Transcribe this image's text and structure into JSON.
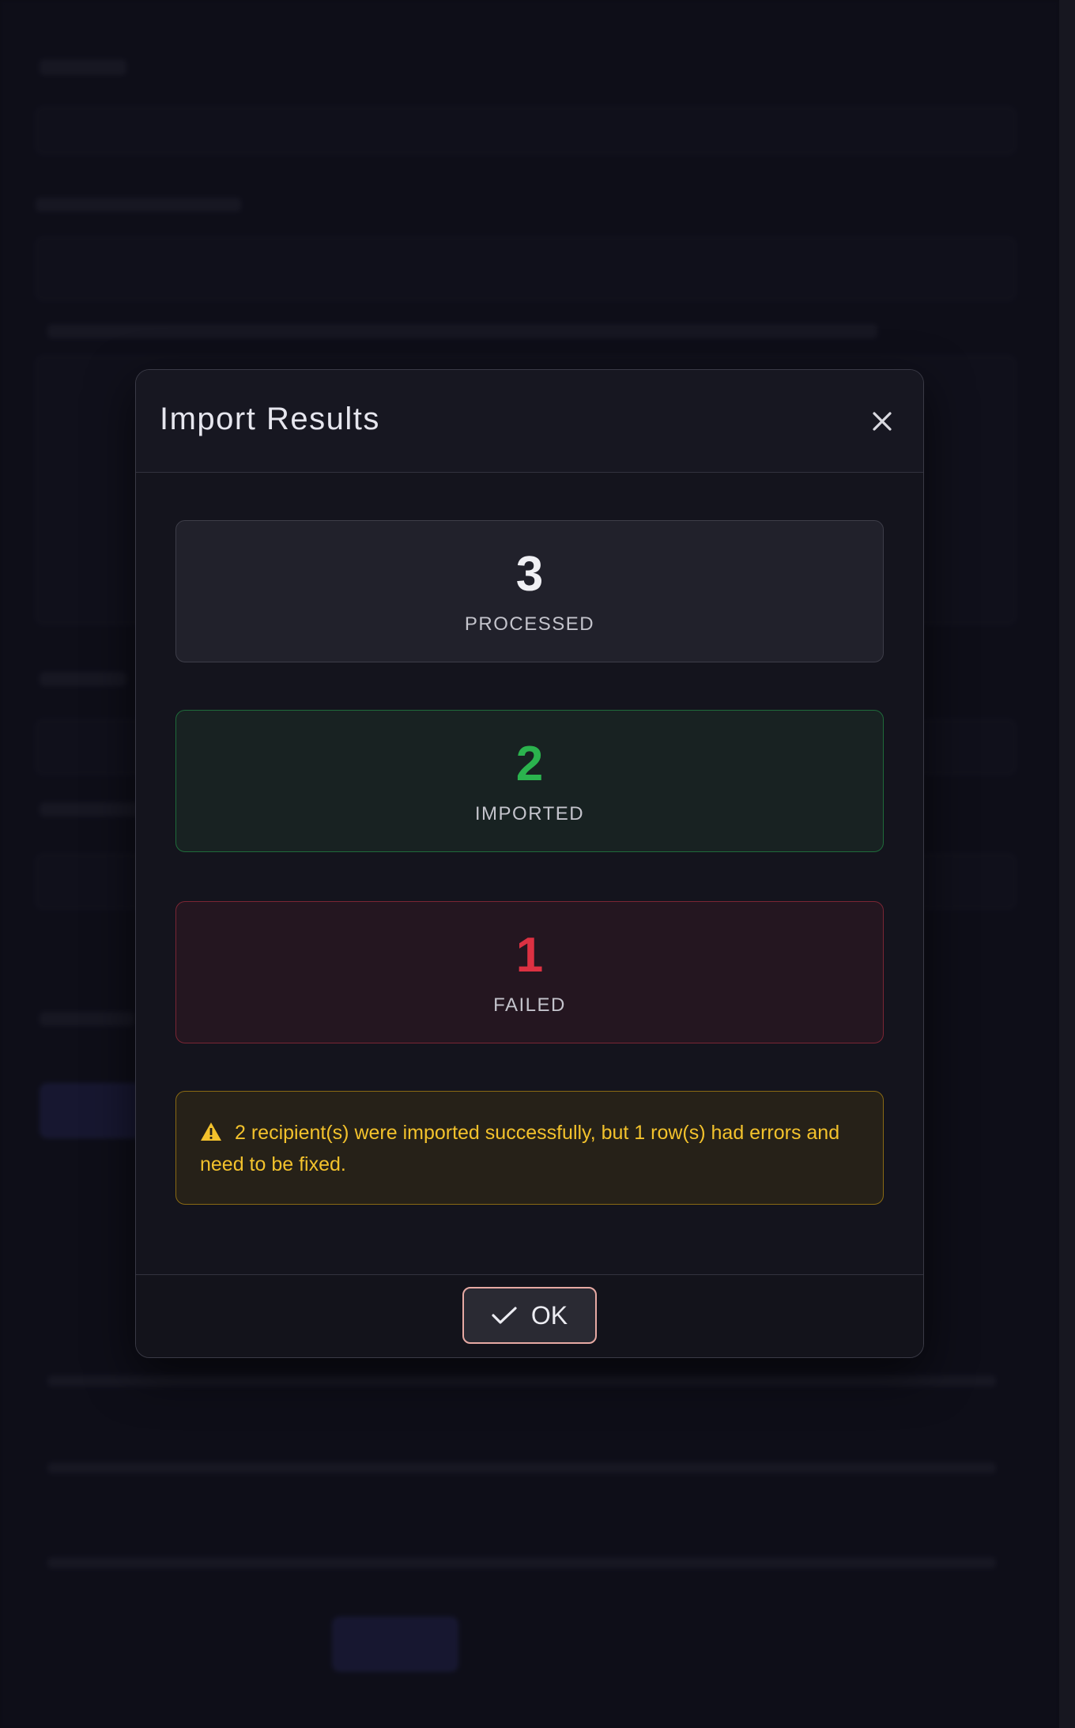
{
  "modal": {
    "title": "Import Results",
    "close_icon": "close-icon",
    "stats": [
      {
        "value": "3",
        "label": "PROCESSED"
      },
      {
        "value": "2",
        "label": "IMPORTED"
      },
      {
        "value": "1",
        "label": "FAILED"
      }
    ],
    "alert": {
      "icon": "warning-icon",
      "text": "2 recipient(s) were imported successfully, but 1 row(s) had errors and need to be fixed."
    },
    "ok_button": {
      "icon": "check-icon",
      "label": "OK"
    }
  },
  "colors": {
    "imported": "#2bb34e",
    "failed": "#dc3142",
    "warning": "#f3c22c",
    "ok_border": "#e6a9a3"
  }
}
